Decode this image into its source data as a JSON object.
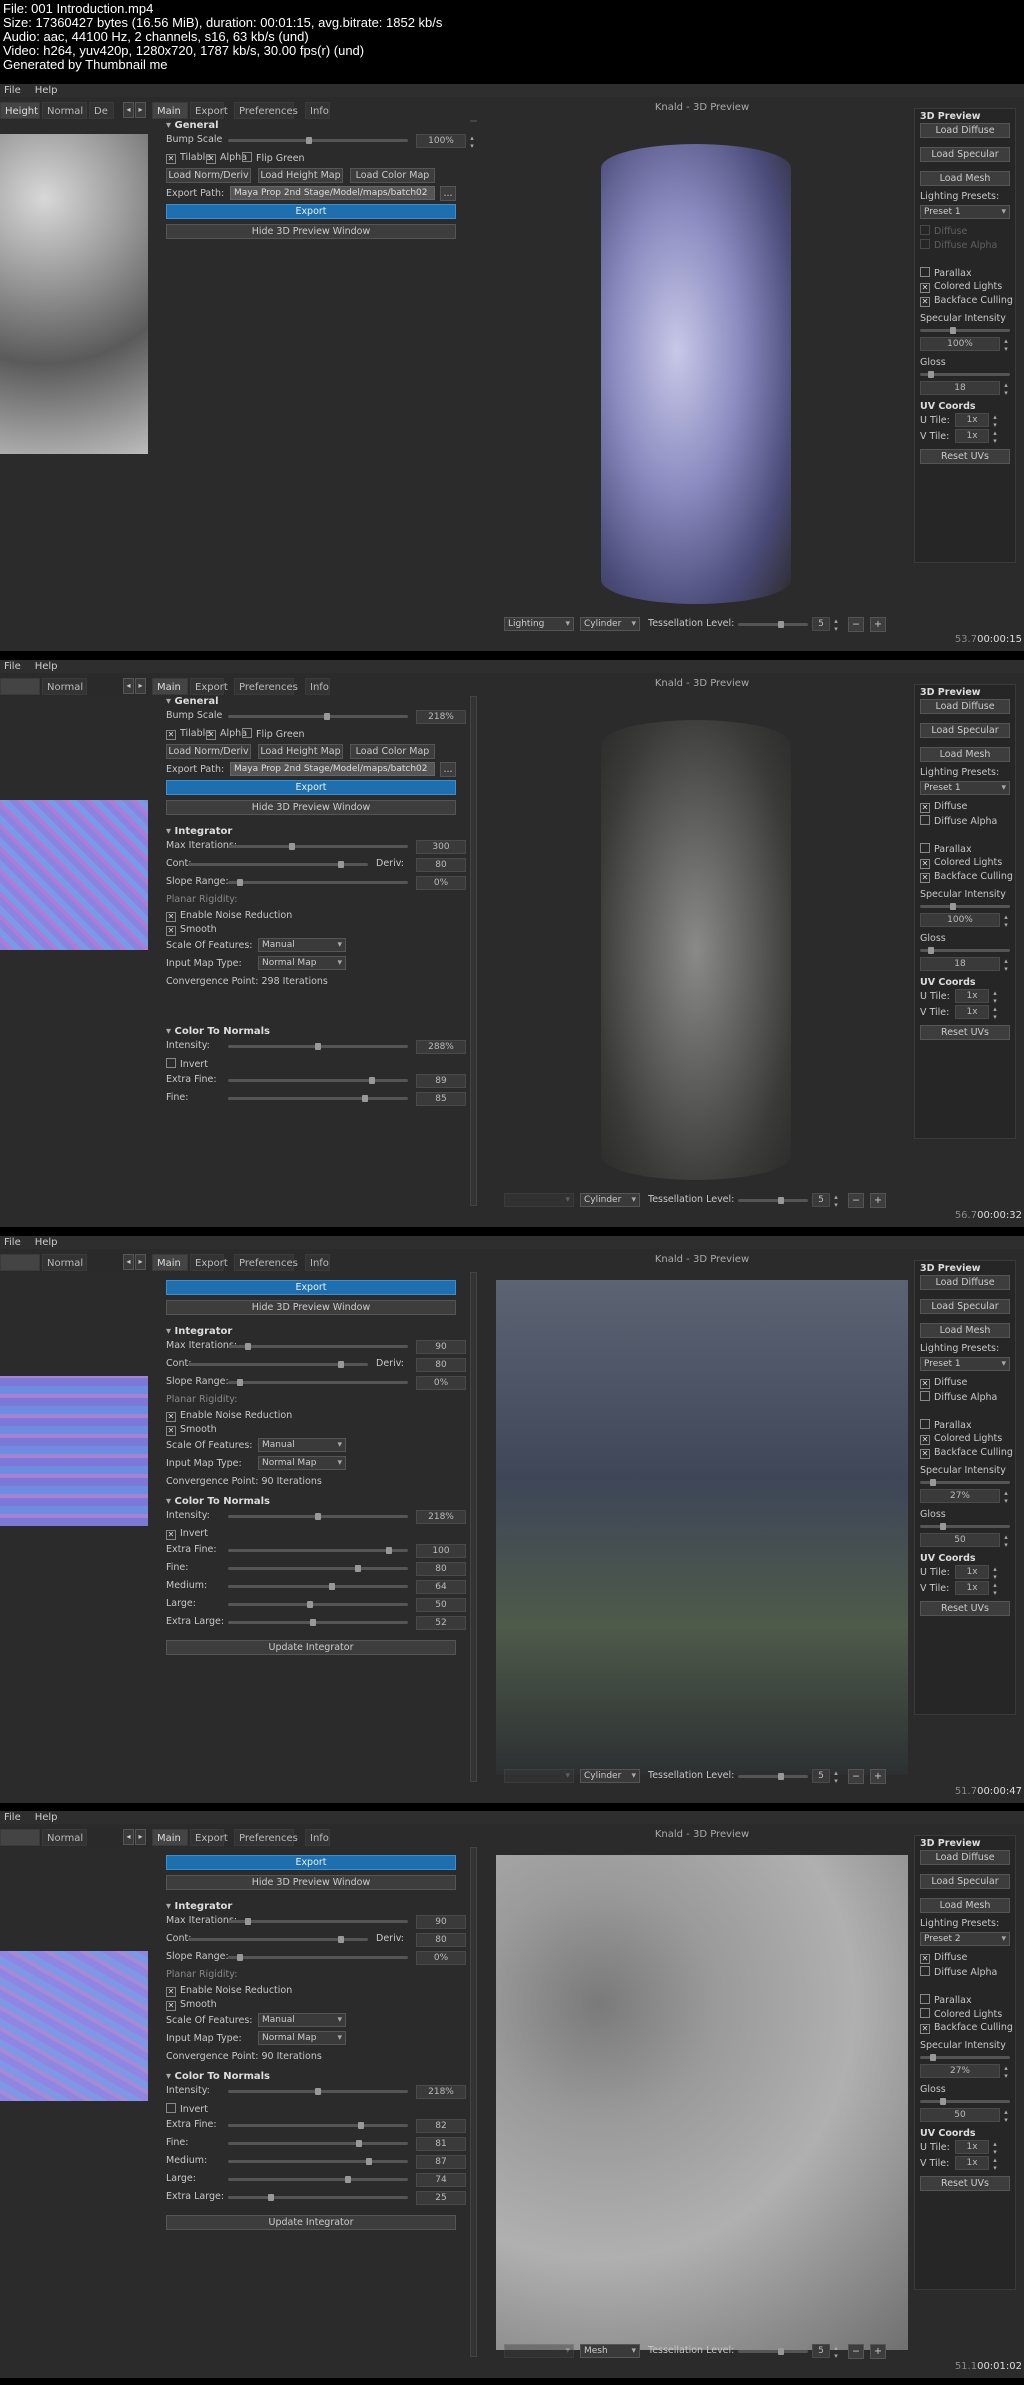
{
  "file_info": [
    "File: 001 Introduction.mp4",
    "Size: 17360427 bytes (16.56 MiB), duration: 00:01:15, avg.bitrate: 1852 kb/s",
    "Audio: aac, 44100 Hz, 2 channels, s16, 63 kb/s (und)",
    "Video: h264, yuv420p, 1280x720, 1787 kb/s, 30.00 fps(r) (und)",
    "Generated by Thumbnail me"
  ],
  "menu": {
    "file": "File",
    "help": "Help"
  },
  "nav_tabs": {
    "main": "Main",
    "export": "Export",
    "preferences": "Preferences",
    "info": "Info"
  },
  "viewport_title": "Knald - 3D Preview",
  "general": {
    "header": "General",
    "bump_scale_label": "Bump Scale",
    "tilable": "Tilable",
    "alpha": "Alpha",
    "flip_green": "Flip Green",
    "load_norm": "Load Norm/Deriv",
    "load_height": "Load Height Map",
    "load_color": "Load Color Map",
    "export_path_label": "Export Path:",
    "export_path_value": "Maya Prop 2nd Stage/Model/maps/batch02",
    "browse": "...",
    "export_button": "Export",
    "hide_preview": "Hide 3D Preview Window"
  },
  "integrator": {
    "header": "Integrator",
    "max_iterations": "Max Iterations:",
    "cont": "Cont:",
    "deriv": "Deriv:",
    "slope_range": "Slope Range:",
    "planar_rigidity": "Planar Rigidity:",
    "enable_noise": "Enable Noise Reduction",
    "smooth": "Smooth",
    "scale_of_features": "Scale Of Features:",
    "scale_value": "Manual",
    "input_map_type": "Input Map Type:",
    "input_map_value": "Normal Map",
    "convergence_prefix": "Convergence Point:",
    "update_integrator": "Update Integrator"
  },
  "color_to_normals": {
    "header": "Color To Normals",
    "intensity": "Intensity:",
    "invert": "Invert",
    "extra_fine": "Extra Fine:",
    "fine": "Fine:",
    "medium": "Medium:",
    "large": "Large:",
    "extra_large": "Extra Large:"
  },
  "right_panel": {
    "title": "3D Preview",
    "load_diffuse": "Load Diffuse",
    "load_specular": "Load Specular",
    "load_mesh": "Load Mesh",
    "lighting_presets": "Lighting Presets:",
    "diffuse": "Diffuse",
    "diffuse_alpha": "Diffuse Alpha",
    "parallax": "Parallax",
    "colored_lights": "Colored Lights",
    "backface_culling": "Backface Culling",
    "specular_intensity": "Specular Intensity",
    "gloss": "Gloss",
    "uv_coords": "UV Coords",
    "u_tile": "U Tile:",
    "v_tile": "V Tile:",
    "reset_uvs": "Reset UVs"
  },
  "bottom_bar": {
    "tessellation": "Tessellation Level:"
  },
  "frames": [
    {
      "time": "00:00:15",
      "frame_no": "53.7",
      "left_tabs": [
        "Height",
        "Normal",
        "De"
      ],
      "bump_scale": "100%",
      "mode": "general_only",
      "preset": "Preset 1",
      "spec": "100%",
      "gloss": "18",
      "u_tile": "1x",
      "v_tile": "1x",
      "dropdown1": "Lighting",
      "dropdown2": "Cylinder",
      "tess": "5",
      "colored_lights": true,
      "diffuse": false
    },
    {
      "time": "00:00:32",
      "frame_no": "56.7",
      "left_tabs": [
        "",
        "Normal"
      ],
      "bump_scale": "218%",
      "mode": "full",
      "max_iter": "300",
      "cont": "80",
      "slope": "0%",
      "convergence": "298 Iterations",
      "intensity": "288%",
      "invert": false,
      "extra_fine": "89",
      "fine": "85",
      "preset": "Preset 1",
      "spec": "100%",
      "gloss": "18",
      "u_tile": "1x",
      "v_tile": "1x",
      "dropdown1": "",
      "dropdown2": "Cylinder",
      "tess": "5",
      "colored_lights": true,
      "diffuse": true
    },
    {
      "time": "00:00:47",
      "frame_no": "51.7",
      "left_tabs": [
        "",
        "Normal"
      ],
      "mode": "scrolled",
      "max_iter": "90",
      "cont": "80",
      "slope": "0%",
      "convergence": "90 Iterations",
      "intensity": "218%",
      "invert": true,
      "extra_fine": "100",
      "fine": "80",
      "medium": "64",
      "large": "50",
      "extra_large": "52",
      "preset": "Preset 1",
      "spec": "27%",
      "gloss": "50",
      "u_tile": "1x",
      "v_tile": "1x",
      "dropdown1": "",
      "dropdown2": "Cylinder",
      "tess": "5",
      "colored_lights": true,
      "diffuse": true
    },
    {
      "time": "00:01:02",
      "frame_no": "51.1",
      "left_tabs": [
        "",
        "Normal"
      ],
      "mode": "scrolled",
      "max_iter": "90",
      "cont": "80",
      "slope": "0%",
      "convergence": "90 Iterations",
      "intensity": "218%",
      "invert": false,
      "extra_fine": "82",
      "fine": "81",
      "medium": "87",
      "large": "74",
      "extra_large": "25",
      "preset": "Preset 2",
      "spec": "27%",
      "gloss": "50",
      "u_tile": "1x",
      "v_tile": "1x",
      "dropdown1": "",
      "dropdown2": "Mesh",
      "tess": "5",
      "colored_lights": false,
      "diffuse": true
    }
  ]
}
